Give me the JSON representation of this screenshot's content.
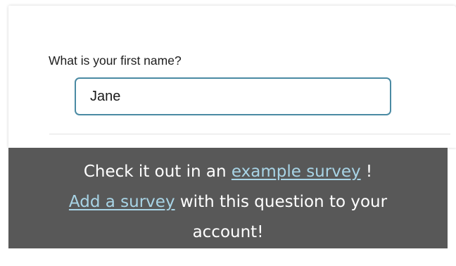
{
  "question": {
    "label": "What is your first name?",
    "answer_value": "Jane"
  },
  "banner": {
    "line1_prefix": "Check it out in an",
    "example_link": "example survey",
    "line1_suffix": "!",
    "add_link": "Add a survey",
    "line2_rest": "with this question to your",
    "line3": "account!"
  },
  "colors": {
    "input_border": "#4a8aa3",
    "banner_bg": "#585858",
    "link": "#a8d4e6"
  }
}
